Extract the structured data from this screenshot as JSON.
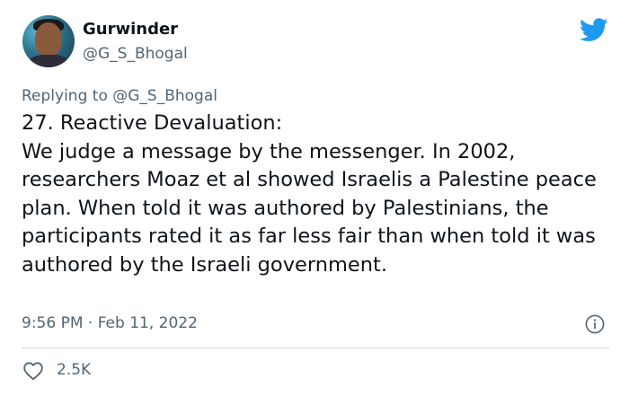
{
  "author": {
    "display_name": "Gurwinder",
    "handle": "@G_S_Bhogal",
    "avatar_icon": "profile-photo"
  },
  "brand": {
    "icon": "twitter-bird-icon",
    "color": "#1d9bf0"
  },
  "reply": {
    "prefix": "Replying to ",
    "to_handle": "@G_S_Bhogal"
  },
  "tweet": {
    "text": "27. Reactive Devaluation:\nWe judge a message by the messenger. In 2002, researchers Moaz et al showed Israelis a Palestine peace plan. When told it was authored by Palestinians, the participants rated it as far less fair than when told it was authored by the Israeli government.",
    "timestamp": "9:56 PM · Feb 11, 2022"
  },
  "stats": {
    "likes": "2.5K"
  },
  "colors": {
    "text": "#0f1419",
    "secondary": "#536471",
    "divider": "#cfd9de"
  }
}
